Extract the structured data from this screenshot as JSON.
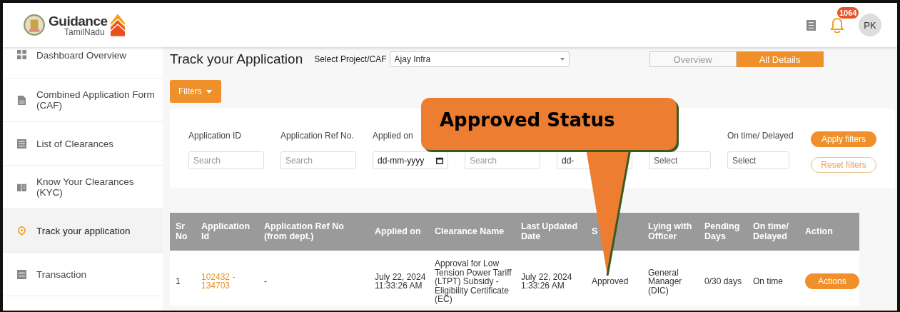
{
  "header": {
    "logo_title": "Guidance",
    "logo_subtitle": "TamilNadu",
    "notification_count": "1064",
    "avatar_initials": "PK"
  },
  "sidebar": {
    "items": [
      {
        "label": "Dashboard Overview",
        "selected": false
      },
      {
        "label": "Combined Application Form (CAF)",
        "selected": false
      },
      {
        "label": "List of Clearances",
        "selected": false
      },
      {
        "label": "Know Your Clearances (KYC)",
        "selected": false
      },
      {
        "label": "Track your application",
        "selected": true
      },
      {
        "label": "Transaction",
        "selected": false
      }
    ]
  },
  "page": {
    "title": "Track your Application",
    "project_label": "Select Project/CAF",
    "project_value": "Ajay Infra",
    "view_tabs": [
      {
        "label": "Overview",
        "selected": false
      },
      {
        "label": "All Details",
        "selected": true
      }
    ],
    "filters_button": "Filters",
    "filters": [
      {
        "label": "Application ID",
        "kind": "text",
        "placeholder": "Search"
      },
      {
        "label": "Application Ref No.",
        "kind": "text",
        "placeholder": "Search"
      },
      {
        "label": "Applied on",
        "kind": "date",
        "value": "dd-mm-yyyy"
      },
      {
        "kind": "text",
        "placeholder": "Search"
      },
      {
        "kind": "date",
        "value": "dd-"
      },
      {
        "kind": "select",
        "value": "Select"
      },
      {
        "label": "On time/ Delayed",
        "kind": "select",
        "value": "Select"
      }
    ],
    "apply_button": "Apply filters",
    "reset_button": "Reset filters",
    "table": {
      "columns": [
        "Sr No",
        "Application Id",
        "Application Ref No (from dept.)",
        "Applied on",
        "Clearance Name",
        "Last Updated Date",
        "S",
        "Lying with Officer",
        "Pending Days",
        "On time/ Delayed",
        "Action"
      ],
      "rows": [
        {
          "sr": "1",
          "application_id": "102432 - 134703",
          "ref_no": "-",
          "applied_on": "July 22, 2024 11:33:26 AM",
          "clearance_name": "Approval for Low Tension Power Tariff (LTPT) Subsidy - Eligibility Certificate (EC)",
          "last_updated": "July 22, 2024 1:33:26 AM",
          "status": "Approved",
          "lying_with": "General Manager (DIC)",
          "pending_days": "0/30 days",
          "on_time": "On time",
          "action": "Actions"
        }
      ]
    }
  },
  "callout": {
    "text": "Approved Status"
  }
}
